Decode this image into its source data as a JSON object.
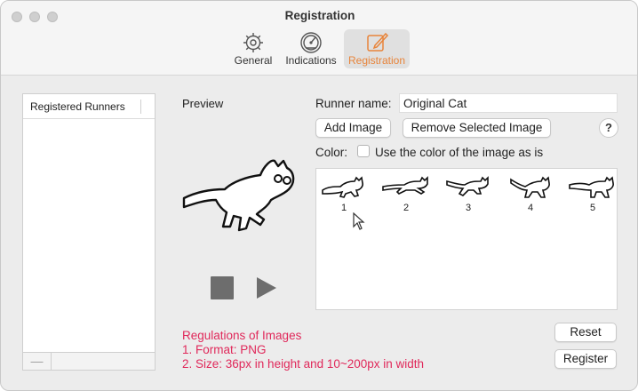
{
  "window": {
    "title": "Registration"
  },
  "toolbar": {
    "tabs": [
      {
        "label": "General",
        "icon": "gear-icon"
      },
      {
        "label": "Indications",
        "icon": "gauge-icon"
      },
      {
        "label": "Registration",
        "icon": "pencil-square-icon",
        "selected": true
      }
    ],
    "selected_color": "#e8843a"
  },
  "sidebar": {
    "header": "Registered Runners",
    "remove_label": "—"
  },
  "preview": {
    "label": "Preview"
  },
  "form": {
    "runner_name_label": "Runner name:",
    "runner_name_value": "Original Cat",
    "add_image_label": "Add Image",
    "remove_image_label": "Remove Selected Image",
    "help_label": "?",
    "color_label": "Color:",
    "color_checkbox_label": "Use the color of the image as is",
    "color_checkbox_checked": false
  },
  "frames": [
    {
      "number": "1"
    },
    {
      "number": "2"
    },
    {
      "number": "3"
    },
    {
      "number": "4"
    },
    {
      "number": "5"
    }
  ],
  "regulations": {
    "title": "Regulations of Images",
    "line1": "1. Format: PNG",
    "line2": "2. Size: 36px in height and 10~200px in width",
    "color": "#e0285a"
  },
  "actions": {
    "reset_label": "Reset",
    "register_label": "Register"
  }
}
